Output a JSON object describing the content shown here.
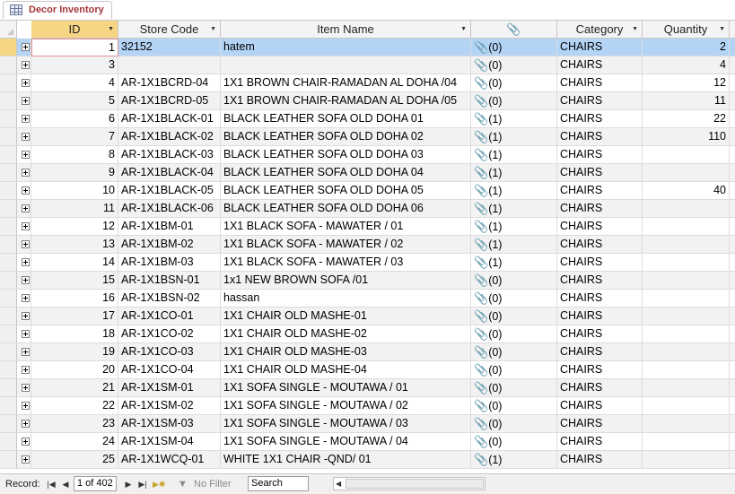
{
  "tab": {
    "label": "Decor Inventory",
    "icon": "table-icon"
  },
  "columns": [
    {
      "key": "id",
      "label": "ID"
    },
    {
      "key": "store_code",
      "label": "Store Code"
    },
    {
      "key": "item_name",
      "label": "Item Name"
    },
    {
      "key": "attachments",
      "label": "",
      "icon": "paperclip-icon"
    },
    {
      "key": "category",
      "label": "Category"
    },
    {
      "key": "quantity",
      "label": "Quantity"
    }
  ],
  "rows": [
    {
      "id": "1",
      "store_code": "32152",
      "item_name": "hatem",
      "attachments": "(0)",
      "category": "CHAIRS",
      "quantity": "2"
    },
    {
      "id": "3",
      "store_code": "",
      "item_name": "",
      "attachments": "(0)",
      "category": "CHAIRS",
      "quantity": "4"
    },
    {
      "id": "4",
      "store_code": "AR-1X1BCRD-04",
      "item_name": "1X1 BROWN CHAIR-RAMADAN AL DOHA /04",
      "attachments": "(0)",
      "category": "CHAIRS",
      "quantity": "12"
    },
    {
      "id": "5",
      "store_code": "AR-1X1BCRD-05",
      "item_name": "1X1 BROWN CHAIR-RAMADAN AL DOHA /05",
      "attachments": "(0)",
      "category": "CHAIRS",
      "quantity": "11"
    },
    {
      "id": "6",
      "store_code": "AR-1X1BLACK-01",
      "item_name": "BLACK LEATHER SOFA OLD DOHA 01",
      "attachments": "(1)",
      "category": "CHAIRS",
      "quantity": "22"
    },
    {
      "id": "7",
      "store_code": "AR-1X1BLACK-02",
      "item_name": "BLACK LEATHER SOFA OLD DOHA 02",
      "attachments": "(1)",
      "category": "CHAIRS",
      "quantity": "110"
    },
    {
      "id": "8",
      "store_code": "AR-1X1BLACK-03",
      "item_name": "BLACK LEATHER SOFA OLD DOHA 03",
      "attachments": "(1)",
      "category": "CHAIRS",
      "quantity": ""
    },
    {
      "id": "9",
      "store_code": "AR-1X1BLACK-04",
      "item_name": "BLACK LEATHER SOFA OLD DOHA 04",
      "attachments": "(1)",
      "category": "CHAIRS",
      "quantity": ""
    },
    {
      "id": "10",
      "store_code": "AR-1X1BLACK-05",
      "item_name": "BLACK LEATHER SOFA OLD DOHA 05",
      "attachments": "(1)",
      "category": "CHAIRS",
      "quantity": "40"
    },
    {
      "id": "11",
      "store_code": "AR-1X1BLACK-06",
      "item_name": "BLACK LEATHER SOFA OLD DOHA 06",
      "attachments": "(1)",
      "category": "CHAIRS",
      "quantity": ""
    },
    {
      "id": "12",
      "store_code": "AR-1X1BM-01",
      "item_name": "1X1 BLACK SOFA - MAWATER / 01",
      "attachments": "(1)",
      "category": "CHAIRS",
      "quantity": ""
    },
    {
      "id": "13",
      "store_code": "AR-1X1BM-02",
      "item_name": "1X1 BLACK SOFA - MAWATER / 02",
      "attachments": "(1)",
      "category": "CHAIRS",
      "quantity": ""
    },
    {
      "id": "14",
      "store_code": "AR-1X1BM-03",
      "item_name": "1X1 BLACK SOFA - MAWATER / 03",
      "attachments": "(1)",
      "category": "CHAIRS",
      "quantity": ""
    },
    {
      "id": "15",
      "store_code": "AR-1X1BSN-01",
      "item_name": "1x1 NEW BROWN SOFA /01",
      "attachments": "(0)",
      "category": "CHAIRS",
      "quantity": ""
    },
    {
      "id": "16",
      "store_code": "AR-1X1BSN-02",
      "item_name": "hassan",
      "attachments": "(0)",
      "category": "CHAIRS",
      "quantity": ""
    },
    {
      "id": "17",
      "store_code": "AR-1X1CO-01",
      "item_name": "1X1 CHAIR OLD MASHE-01",
      "attachments": "(0)",
      "category": "CHAIRS",
      "quantity": ""
    },
    {
      "id": "18",
      "store_code": "AR-1X1CO-02",
      "item_name": "1X1 CHAIR OLD MASHE-02",
      "attachments": "(0)",
      "category": "CHAIRS",
      "quantity": ""
    },
    {
      "id": "19",
      "store_code": "AR-1X1CO-03",
      "item_name": "1X1 CHAIR OLD MASHE-03",
      "attachments": "(0)",
      "category": "CHAIRS",
      "quantity": ""
    },
    {
      "id": "20",
      "store_code": "AR-1X1CO-04",
      "item_name": "1X1 CHAIR OLD MASHE-04",
      "attachments": "(0)",
      "category": "CHAIRS",
      "quantity": ""
    },
    {
      "id": "21",
      "store_code": "AR-1X1SM-01",
      "item_name": "1X1 SOFA SINGLE - MOUTAWA / 01",
      "attachments": "(0)",
      "category": "CHAIRS",
      "quantity": ""
    },
    {
      "id": "22",
      "store_code": "AR-1X1SM-02",
      "item_name": "1X1 SOFA SINGLE - MOUTAWA / 02",
      "attachments": "(0)",
      "category": "CHAIRS",
      "quantity": ""
    },
    {
      "id": "23",
      "store_code": "AR-1X1SM-03",
      "item_name": "1X1 SOFA SINGLE - MOUTAWA / 03",
      "attachments": "(0)",
      "category": "CHAIRS",
      "quantity": ""
    },
    {
      "id": "24",
      "store_code": "AR-1X1SM-04",
      "item_name": "1X1 SOFA SINGLE - MOUTAWA / 04",
      "attachments": "(0)",
      "category": "CHAIRS",
      "quantity": ""
    },
    {
      "id": "25",
      "store_code": "AR-1X1WCQ-01",
      "item_name": "WHITE 1X1 CHAIR -QND/ 01",
      "attachments": "(1)",
      "category": "CHAIRS",
      "quantity": ""
    }
  ],
  "status": {
    "record_label": "Record:",
    "record_position": "1 of 402",
    "filter_label": "No Filter",
    "search_placeholder": "Search"
  }
}
